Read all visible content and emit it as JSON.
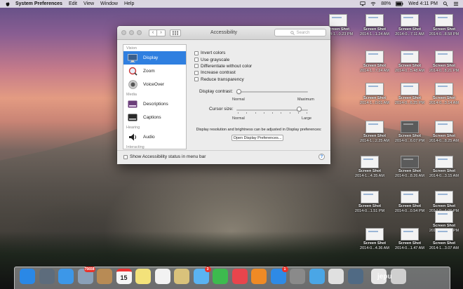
{
  "menubar": {
    "app_name": "System Preferences",
    "items": [
      "Edit",
      "View",
      "Window",
      "Help"
    ],
    "battery": "88%",
    "clock": "Wed 4:11 PM"
  },
  "window": {
    "title": "Accessibility",
    "search_placeholder": "Search",
    "sidebar": {
      "categories": {
        "vision": "Vision",
        "media": "Media",
        "hearing": "Hearing",
        "interacting": "Interacting"
      },
      "items": [
        {
          "label": "Display",
          "icon": "display-icon",
          "selected": true
        },
        {
          "label": "Zoom",
          "icon": "zoom-icon",
          "selected": false
        },
        {
          "label": "VoiceOver",
          "icon": "voiceover-icon",
          "selected": false
        },
        {
          "label": "Descriptions",
          "icon": "descriptions-icon",
          "selected": false
        },
        {
          "label": "Captions",
          "icon": "captions-icon",
          "selected": false
        },
        {
          "label": "Audio",
          "icon": "audio-icon",
          "selected": false
        }
      ]
    },
    "display": {
      "checkboxes": [
        "Invert colors",
        "Use grayscale",
        "Differentiate without color",
        "Increase contrast",
        "Reduce transparency"
      ],
      "contrast": {
        "label": "Display contrast:",
        "min_label": "Normal",
        "max_label": "Maximum",
        "value": 0.0
      },
      "cursor": {
        "label": "Cursor size:",
        "min_label": "Normal",
        "max_label": "Large",
        "value": 0.9
      },
      "note": "Display resolution and brightness can be adjusted in Display preferences:",
      "open_button": "Open Display Preferences..."
    },
    "show_status_label": "Show Accessibility status in menu bar",
    "help": "?"
  },
  "desktop_files": [
    {
      "line1": "Screen Shot",
      "line2": "2014-1...0.23 PM"
    },
    {
      "line1": "Screen Shot",
      "line2": "2014-1...1.24 AM"
    },
    {
      "line1": "Screen Shot",
      "line2": "2014-0...7.11 AM"
    },
    {
      "line1": "Screen Shot",
      "line2": "2014-0...8.58 PM"
    },
    {
      "line1": "Screen Shot",
      "line2": "2014-1...7.24 AM"
    },
    {
      "line1": "Screen Shot",
      "line2": "2014-0...5.48 AM"
    },
    {
      "line1": "Screen Shot",
      "line2": "2014-0...8.21 PM"
    },
    {
      "line1": "Screen Shot",
      "line2": "2014-1...0.01 AM"
    },
    {
      "line1": "Screen Shot",
      "line2": "2014-0...6.25 PM"
    },
    {
      "line1": "Screen Shot",
      "line2": "2014-0...3.14 AM"
    },
    {
      "line1": "Screen Shot",
      "line2": "2014-1...2.25 AM"
    },
    {
      "line1": "Screen Shot",
      "line2": "2014-0...6.07 PM"
    },
    {
      "line1": "Screen Shot",
      "line2": "2014-0...8.25 AM"
    },
    {
      "line1": "Screen Shot",
      "line2": "2014-1...4.35 AM"
    },
    {
      "line1": "Screen Shot",
      "line2": "2014-0...8.26 AM"
    },
    {
      "line1": "Screen Shot",
      "line2": "2014-0...3.15 AM"
    },
    {
      "line1": "Screen Shot",
      "line2": "2014-0...1.51 PM"
    },
    {
      "line1": "Screen Shot",
      "line2": "2014-0...0.54 PM"
    },
    {
      "line1": "Screen Shot",
      "line2": "2014-0...4.06 PM"
    },
    {
      "line1": "Screen Shot",
      "line2": "2014-0...8.51 PM"
    },
    {
      "line1": "Screen Shot",
      "line2": "2014-1...3.07 AM"
    },
    {
      "line1": "Screen Shot",
      "line2": "2014-0...4.36 AM"
    },
    {
      "line1": "Screen Shot",
      "line2": "2014-0...1.47 AM"
    }
  ],
  "dock": {
    "apps": [
      {
        "name": "finder-icon",
        "color": "#2a88e6"
      },
      {
        "name": "launchpad-icon",
        "color": "#5d6c7c"
      },
      {
        "name": "safari-icon",
        "color": "#3c97e8"
      },
      {
        "name": "mail-icon",
        "color": "#8aa0b8",
        "badge": "75658"
      },
      {
        "name": "contacts-icon",
        "color": "#b88b55"
      },
      {
        "name": "calendar-icon",
        "color": "#f6f6f6",
        "text": "15"
      },
      {
        "name": "notes-icon",
        "color": "#f3e27a"
      },
      {
        "name": "reminders-icon",
        "color": "#f2f2f2"
      },
      {
        "name": "photos-icon",
        "color": "#d9c27b"
      },
      {
        "name": "messages-icon",
        "color": "#5ab3f2",
        "badge": "3"
      },
      {
        "name": "facetime-icon",
        "color": "#3dbb4e"
      },
      {
        "name": "itunes-icon",
        "color": "#e8454c"
      },
      {
        "name": "ibooks-icon",
        "color": "#ef8a25"
      },
      {
        "name": "app-store-icon",
        "color": "#2e8ae6",
        "badge": "1"
      },
      {
        "name": "system-preferences-icon",
        "color": "#8a8a8a"
      },
      {
        "name": "twitter-icon",
        "color": "#4aa6e6"
      },
      {
        "name": "chrome-icon",
        "color": "#e0e0e0"
      },
      {
        "name": "quicktime-icon",
        "color": "#506a84"
      },
      {
        "name": "documents-icon",
        "color": "#e6e6e6"
      },
      {
        "name": "trash-icon",
        "color": "#cfcfcf"
      }
    ],
    "watermark": "jepu"
  }
}
